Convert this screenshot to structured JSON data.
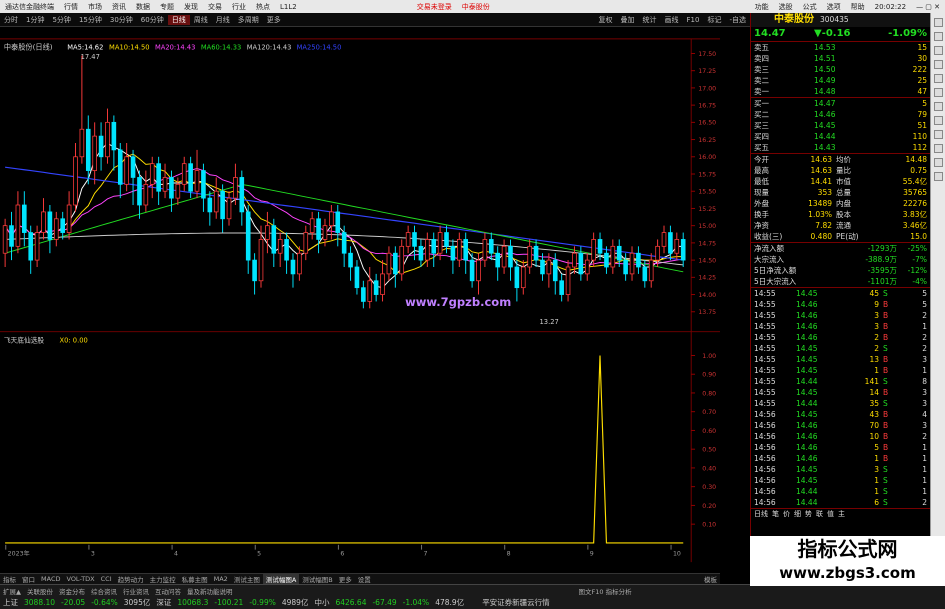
{
  "menubar": {
    "app_title": "通达信金融终端",
    "items": [
      "行情",
      "市场",
      "资讯",
      "数据",
      "专题",
      "发现",
      "交易",
      "行业",
      "热点",
      "L1L2"
    ],
    "center_items": [
      "交易未登录",
      "中泰股份"
    ],
    "right_items": [
      "功能",
      "选股",
      "公式",
      "选项",
      "帮助"
    ],
    "clock": "20:02:22"
  },
  "toolbar": {
    "periods": [
      "分时",
      "1分钟",
      "5分钟",
      "15分钟",
      "30分钟",
      "60分钟",
      "日线",
      "周线",
      "月线",
      "多周期",
      "更多"
    ],
    "active": "日线",
    "right_buttons": [
      "复权",
      "叠加",
      "统计",
      "画线",
      "F10",
      "标记",
      "-自选"
    ]
  },
  "chart": {
    "stock_label": "中泰股份(日线)",
    "ma_legend": [
      {
        "name": "MA5",
        "value": "14.62",
        "color": "#ffffff"
      },
      {
        "name": "MA10",
        "value": "14.50",
        "color": "#ffde00"
      },
      {
        "name": "MA20",
        "value": "14.43",
        "color": "#ff44ff"
      },
      {
        "name": "MA60",
        "value": "14.33",
        "color": "#22dd22"
      },
      {
        "name": "MA120",
        "value": "14.43",
        "color": "#cccccc"
      },
      {
        "name": "MA250",
        "value": "14.50",
        "color": "#3344ff"
      }
    ],
    "high_label": "17.47",
    "low_label": "13.27",
    "watermark": "www.7gpzb.com",
    "price_ticks": [
      "17.50",
      "17.25",
      "17.00",
      "16.75",
      "16.50",
      "16.25",
      "16.00",
      "15.75",
      "15.50",
      "15.25",
      "15.00",
      "14.75",
      "14.50",
      "14.25",
      "14.00",
      "13.75"
    ],
    "indicator_label": "飞天底仙选股",
    "indicator_value": "X0: 0.00",
    "indicator_ticks": [
      "1.00",
      "0.90",
      "0.80",
      "0.70",
      "0.60",
      "0.50",
      "0.40",
      "0.30",
      "0.20",
      "0.10"
    ],
    "x_labels": [
      "2023年",
      "3",
      "4",
      "5",
      "6",
      "7",
      "8",
      "9",
      "10"
    ],
    "candle_color_up": "#ff3b3b",
    "candle_color_down": "#00e5ff"
  },
  "tabs": {
    "items": [
      "指标",
      "窗口",
      "MACD",
      "VOL-TDX",
      "CCI",
      "趋势动力",
      "主力监控",
      "私募主图",
      "MA2",
      "测试主图",
      "测试幅图A",
      "测试幅图B",
      "更多",
      "设置"
    ],
    "active": "测试幅图A",
    "row2_items": [
      "扩展▲",
      "关联股份",
      "资金分布",
      "综合资讯",
      "行业资讯",
      "互动问答",
      "量及新功能说明"
    ],
    "right_label": "模板",
    "right_tail": "图文F10 指标分析"
  },
  "quote": {
    "name": "中泰股份",
    "code": "300435",
    "price": "14.47",
    "change": "▼-0.16",
    "pct": "-1.09%",
    "asks": [
      {
        "label": "卖五",
        "price": "14.53",
        "vol": "15"
      },
      {
        "label": "卖四",
        "price": "14.51",
        "vol": "30"
      },
      {
        "label": "卖三",
        "price": "14.50",
        "vol": "222"
      },
      {
        "label": "卖二",
        "price": "14.49",
        "vol": "25"
      },
      {
        "label": "卖一",
        "price": "14.48",
        "vol": "47"
      }
    ],
    "bids": [
      {
        "label": "买一",
        "price": "14.47",
        "vol": "5"
      },
      {
        "label": "买二",
        "price": "14.46",
        "vol": "79"
      },
      {
        "label": "买三",
        "price": "14.45",
        "vol": "51"
      },
      {
        "label": "买四",
        "price": "14.44",
        "vol": "110"
      },
      {
        "label": "买五",
        "price": "14.43",
        "vol": "112"
      }
    ],
    "stats": [
      {
        "l1": "今开",
        "v1": "14.63",
        "l2": "均价",
        "v2": "14.48"
      },
      {
        "l1": "最高",
        "v1": "14.63",
        "l2": "量比",
        "v2": "0.75"
      },
      {
        "l1": "最低",
        "v1": "14.41",
        "l2": "市值",
        "v2": "55.4亿"
      },
      {
        "l1": "现量",
        "v1": "353",
        "l2": "总量",
        "v2": "35765"
      },
      {
        "l1": "外盘",
        "v1": "13489",
        "l2": "内盘",
        "v2": "22276"
      },
      {
        "l1": "换手",
        "v1": "1.03%",
        "l2": "股本",
        "v2": "3.83亿"
      },
      {
        "l1": "净资",
        "v1": "7.82",
        "l2": "流通",
        "v2": "3.46亿"
      },
      {
        "l1": "收益(三)",
        "v1": "0.480",
        "l2": "PE(动)",
        "v2": "15.0"
      }
    ],
    "flows": [
      {
        "label": "净流入额",
        "value": "-1293万",
        "pct": "-25%"
      },
      {
        "label": "大宗流入",
        "value": "-388.9万",
        "pct": "-7%"
      },
      {
        "label": "5日净流入额",
        "value": "-3595万",
        "pct": "-12%"
      },
      {
        "label": "5日大宗流入",
        "value": "-1101万",
        "pct": "-4%"
      }
    ],
    "ticks": [
      {
        "t": "14:55",
        "p": "14.45",
        "v": "45",
        "s": "S",
        "n": "5"
      },
      {
        "t": "14:55",
        "p": "14.46",
        "v": "9",
        "s": "B",
        "n": "5"
      },
      {
        "t": "14:55",
        "p": "14.46",
        "v": "3",
        "s": "B",
        "n": "2"
      },
      {
        "t": "14:55",
        "p": "14.46",
        "v": "3",
        "s": "B",
        "n": "1"
      },
      {
        "t": "14:55",
        "p": "14.46",
        "v": "2",
        "s": "B",
        "n": "2"
      },
      {
        "t": "14:55",
        "p": "14.45",
        "v": "2",
        "s": "S",
        "n": "2"
      },
      {
        "t": "14:55",
        "p": "14.45",
        "v": "13",
        "s": "B",
        "n": "3"
      },
      {
        "t": "14:55",
        "p": "14.45",
        "v": "1",
        "s": "B",
        "n": "1"
      },
      {
        "t": "14:55",
        "p": "14.44",
        "v": "141",
        "s": "S",
        "n": "8"
      },
      {
        "t": "14:55",
        "p": "14.45",
        "v": "14",
        "s": "B",
        "n": "3"
      },
      {
        "t": "14:55",
        "p": "14.44",
        "v": "35",
        "s": "S",
        "n": "3"
      },
      {
        "t": "14:56",
        "p": "14.45",
        "v": "43",
        "s": "B",
        "n": "4"
      },
      {
        "t": "14:56",
        "p": "14.46",
        "v": "70",
        "s": "B",
        "n": "3"
      },
      {
        "t": "14:56",
        "p": "14.46",
        "v": "10",
        "s": "B",
        "n": "2"
      },
      {
        "t": "14:56",
        "p": "14.46",
        "v": "5",
        "s": "B",
        "n": "1"
      },
      {
        "t": "14:56",
        "p": "14.46",
        "v": "1",
        "s": "B",
        "n": "1"
      },
      {
        "t": "14:56",
        "p": "14.45",
        "v": "3",
        "s": "S",
        "n": "1"
      },
      {
        "t": "14:56",
        "p": "14.45",
        "v": "1",
        "s": "S",
        "n": "1"
      },
      {
        "t": "14:56",
        "p": "14.44",
        "v": "1",
        "s": "S",
        "n": "1"
      },
      {
        "t": "14:56",
        "p": "14.44",
        "v": "6",
        "s": "S",
        "n": "2"
      }
    ],
    "bottom_labels": [
      "日线",
      "笔",
      "价",
      "细",
      "势",
      "联",
      "值",
      "主"
    ]
  },
  "statusbar": {
    "items": [
      {
        "label": "上证",
        "val": "3088.10",
        "chg": "-20.05",
        "pct": "-0.64%",
        "amt": "3095亿"
      },
      {
        "label": "深证",
        "val": "10068.3",
        "chg": "-100.21",
        "pct": "-0.99%",
        "amt": "4989亿"
      },
      {
        "label": "中小",
        "val": "6426.64",
        "chg": "-67.49",
        "pct": "-1.04%",
        "amt": "478.9亿"
      }
    ],
    "broker": "平安证券新疆云行情"
  },
  "watermark_corner": {
    "line1": "指标公式网",
    "line2": "www.zbgs3.com"
  },
  "chart_data": {
    "type": "candlestick",
    "price_range": [
      13.6,
      17.6
    ],
    "indicator_range": [
      0,
      1.05
    ],
    "candles": [
      [
        14.6,
        15.0,
        15.1,
        14.4
      ],
      [
        15.0,
        14.7,
        15.2,
        14.5
      ],
      [
        14.7,
        15.3,
        15.5,
        14.6
      ],
      [
        15.3,
        14.9,
        15.5,
        14.7
      ],
      [
        14.9,
        14.5,
        15.0,
        14.3
      ],
      [
        14.5,
        14.9,
        15.0,
        14.4
      ],
      [
        14.9,
        15.2,
        15.4,
        14.8
      ],
      [
        15.2,
        14.8,
        15.3,
        14.6
      ],
      [
        14.8,
        15.1,
        15.2,
        14.7
      ],
      [
        15.1,
        14.9,
        15.2,
        14.8
      ],
      [
        14.9,
        15.3,
        15.5,
        14.8
      ],
      [
        15.3,
        16.0,
        16.2,
        15.2
      ],
      [
        16.0,
        16.4,
        17.47,
        15.9
      ],
      [
        16.4,
        15.8,
        16.6,
        15.6
      ],
      [
        15.8,
        16.3,
        16.5,
        15.6
      ],
      [
        16.3,
        16.0,
        16.5,
        15.8
      ],
      [
        16.0,
        16.5,
        16.7,
        15.9
      ],
      [
        16.5,
        16.1,
        16.6,
        15.8
      ],
      [
        16.1,
        15.6,
        16.2,
        15.4
      ],
      [
        15.6,
        16.0,
        16.2,
        15.5
      ],
      [
        16.0,
        15.7,
        16.1,
        15.3
      ],
      [
        15.7,
        15.3,
        15.8,
        15.1
      ],
      [
        15.3,
        15.6,
        15.8,
        15.2
      ],
      [
        15.6,
        15.9,
        16.0,
        15.4
      ],
      [
        15.9,
        15.5,
        16.0,
        15.3
      ],
      [
        15.5,
        15.7,
        15.9,
        15.4
      ],
      [
        15.7,
        15.4,
        15.8,
        15.2
      ],
      [
        15.4,
        15.6,
        15.7,
        15.3
      ],
      [
        15.6,
        15.9,
        16.0,
        15.5
      ],
      [
        15.9,
        15.5,
        16.0,
        15.4
      ],
      [
        15.5,
        15.8,
        16.1,
        15.4
      ],
      [
        15.8,
        15.4,
        15.9,
        15.2
      ],
      [
        15.4,
        15.2,
        15.5,
        15.0
      ],
      [
        15.2,
        15.5,
        15.7,
        15.1
      ],
      [
        15.5,
        15.1,
        15.6,
        14.9
      ],
      [
        15.1,
        15.4,
        15.5,
        15.0
      ],
      [
        15.4,
        15.7,
        15.9,
        15.3
      ],
      [
        15.7,
        15.2,
        15.8,
        15.0
      ],
      [
        15.2,
        14.5,
        15.3,
        14.3
      ],
      [
        14.5,
        14.2,
        14.6,
        14.0
      ],
      [
        14.2,
        14.8,
        15.0,
        14.1
      ],
      [
        14.8,
        15.0,
        15.2,
        14.6
      ],
      [
        15.0,
        14.6,
        15.1,
        14.4
      ],
      [
        14.6,
        14.8,
        14.9,
        14.4
      ],
      [
        14.8,
        14.5,
        14.9,
        14.3
      ],
      [
        14.5,
        14.3,
        14.6,
        14.1
      ],
      [
        14.3,
        14.6,
        14.7,
        14.2
      ],
      [
        14.6,
        14.9,
        15.0,
        14.5
      ],
      [
        14.9,
        15.1,
        15.2,
        14.8
      ],
      [
        15.1,
        14.8,
        15.2,
        14.6
      ],
      [
        14.8,
        15.0,
        15.1,
        14.7
      ],
      [
        15.0,
        15.2,
        15.3,
        14.8
      ],
      [
        15.2,
        14.9,
        15.3,
        14.7
      ],
      [
        14.9,
        14.6,
        15.0,
        14.4
      ],
      [
        14.6,
        14.4,
        14.7,
        14.2
      ],
      [
        14.4,
        14.1,
        14.5,
        14.0
      ],
      [
        14.1,
        13.9,
        14.2,
        13.8
      ],
      [
        13.9,
        14.2,
        14.4,
        13.8
      ],
      [
        14.2,
        14.0,
        14.3,
        13.9
      ],
      [
        14.0,
        14.3,
        14.5,
        13.9
      ],
      [
        14.3,
        14.6,
        14.7,
        14.2
      ],
      [
        14.6,
        14.3,
        14.7,
        14.1
      ],
      [
        14.3,
        14.7,
        14.8,
        14.2
      ],
      [
        14.7,
        14.9,
        15.0,
        14.6
      ],
      [
        14.9,
        14.7,
        15.0,
        14.5
      ],
      [
        14.7,
        14.5,
        14.8,
        14.4
      ],
      [
        14.5,
        14.8,
        14.9,
        14.4
      ],
      [
        14.8,
        14.6,
        14.9,
        14.4
      ],
      [
        14.6,
        14.9,
        15.0,
        14.5
      ],
      [
        14.9,
        14.7,
        15.0,
        14.6
      ],
      [
        14.7,
        14.5,
        14.8,
        14.3
      ],
      [
        14.5,
        14.8,
        14.9,
        14.4
      ],
      [
        14.8,
        14.5,
        14.9,
        14.3
      ],
      [
        14.5,
        14.2,
        14.6,
        14.1
      ],
      [
        14.2,
        14.5,
        14.6,
        14.0
      ],
      [
        14.5,
        14.8,
        14.9,
        14.4
      ],
      [
        14.8,
        14.6,
        14.9,
        14.5
      ],
      [
        14.6,
        14.4,
        14.7,
        14.2
      ],
      [
        14.4,
        14.7,
        14.8,
        14.3
      ],
      [
        14.7,
        14.4,
        14.8,
        14.2
      ],
      [
        14.4,
        14.1,
        14.5,
        13.9
      ],
      [
        14.1,
        14.4,
        14.5,
        14.0
      ],
      [
        14.4,
        14.7,
        14.8,
        14.3
      ],
      [
        14.7,
        14.5,
        14.8,
        14.4
      ],
      [
        14.5,
        14.3,
        14.6,
        14.2
      ],
      [
        14.3,
        14.5,
        14.6,
        14.1
      ],
      [
        14.5,
        14.2,
        14.6,
        14.0
      ],
      [
        14.2,
        14.0,
        14.3,
        13.9
      ],
      [
        14.0,
        14.4,
        14.5,
        13.9
      ],
      [
        14.4,
        14.6,
        14.7,
        14.3
      ],
      [
        14.6,
        14.3,
        14.7,
        14.2
      ],
      [
        14.3,
        14.5,
        14.6,
        14.2
      ],
      [
        14.5,
        14.8,
        14.9,
        14.4
      ],
      [
        14.8,
        14.6,
        14.9,
        14.5
      ],
      [
        14.6,
        14.4,
        14.7,
        14.3
      ],
      [
        14.4,
        14.7,
        14.8,
        14.3
      ],
      [
        14.7,
        14.5,
        14.8,
        14.4
      ],
      [
        14.5,
        14.3,
        14.6,
        14.2
      ],
      [
        14.3,
        14.6,
        14.7,
        14.2
      ],
      [
        14.6,
        14.4,
        14.7,
        14.3
      ],
      [
        14.4,
        14.2,
        14.5,
        14.1
      ],
      [
        14.2,
        14.5,
        14.6,
        14.1
      ],
      [
        14.5,
        14.7,
        14.8,
        14.4
      ],
      [
        14.7,
        14.9,
        15.0,
        14.6
      ],
      [
        14.9,
        14.6,
        15.0,
        14.5
      ],
      [
        14.6,
        14.8,
        14.9,
        14.5
      ],
      [
        14.8,
        14.5,
        14.9,
        14.4
      ]
    ],
    "ma_series": {
      "MA250": {
        "start": 15.85,
        "end": 14.5
      },
      "MA60": {
        "start": 14.6,
        "peak": 15.6,
        "end": 14.33
      },
      "MA120": {
        "start": 14.8,
        "end": 14.43
      }
    },
    "signal_index": 93,
    "signal_value": 1.0
  }
}
